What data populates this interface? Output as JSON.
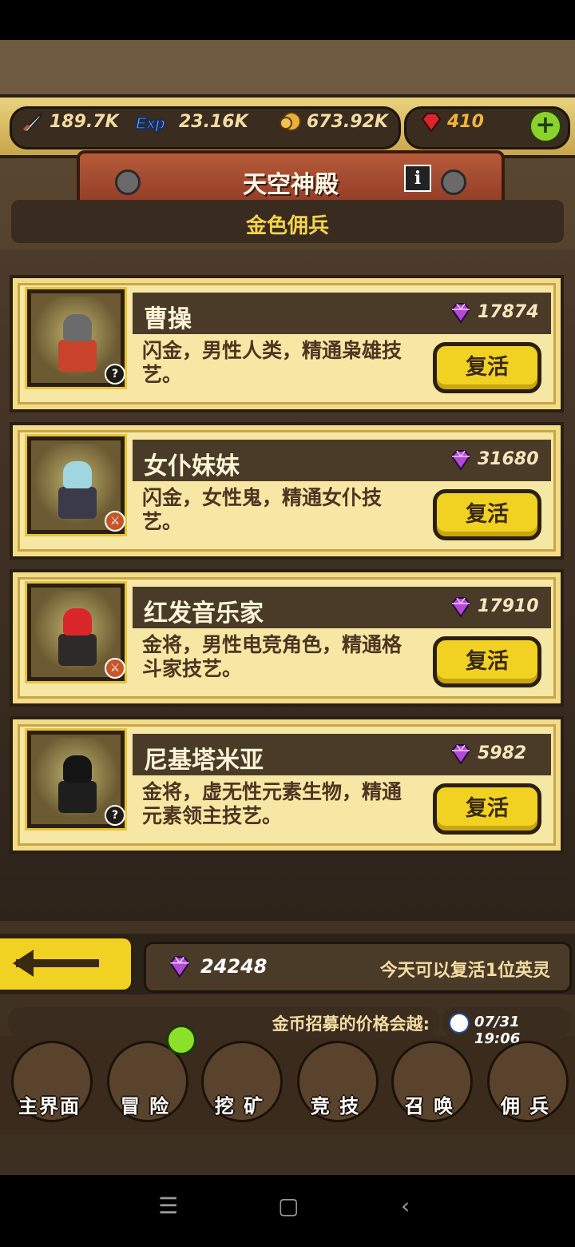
{
  "resources": {
    "attack": "189.7K",
    "exp": "23.16K",
    "gold": "673.92K",
    "gems": "410"
  },
  "header": {
    "title": "天空神殿",
    "info_label": "i",
    "subtitle": "金色佣兵"
  },
  "heroes": [
    {
      "name": "曹操",
      "price": "17874",
      "desc": "闪金，男性人类，精通枭雄技艺。",
      "badge": "?",
      "button": "复活",
      "hair": "#6b6b6b",
      "body": "#c8432a"
    },
    {
      "name": "女仆妹妹",
      "price": "31680",
      "desc": "闪金，女性鬼，精通女仆技艺。",
      "badge": "⚔",
      "button": "复活",
      "hair": "#9fd6e0",
      "body": "#3a3a4a"
    },
    {
      "name": "红发音乐家",
      "price": "17910",
      "desc": "金将，男性电竞角色，精通格斗家技艺。",
      "badge": "⚔",
      "button": "复活",
      "hair": "#d8262a",
      "body": "#2e2a2a"
    },
    {
      "name": "尼基塔米亚",
      "price": "5982",
      "desc": "金将，虚无性元素生物，精通元素领主技艺。",
      "badge": "?",
      "button": "复活",
      "hair": "#141414",
      "body": "#1e1e1e"
    }
  ],
  "footer": {
    "gem_total": "24248",
    "note": "今天可以复活1位英灵",
    "ticker": "金币招募的价格会越:",
    "time": "07/31 19:06"
  },
  "nav": [
    "主界面",
    "冒 险",
    "挖 矿",
    "竞 技",
    "召 唤",
    "佣 兵"
  ],
  "colors": {
    "accent": "#f1d222",
    "panel": "#f2dc88",
    "gem": "#b24ad6"
  }
}
